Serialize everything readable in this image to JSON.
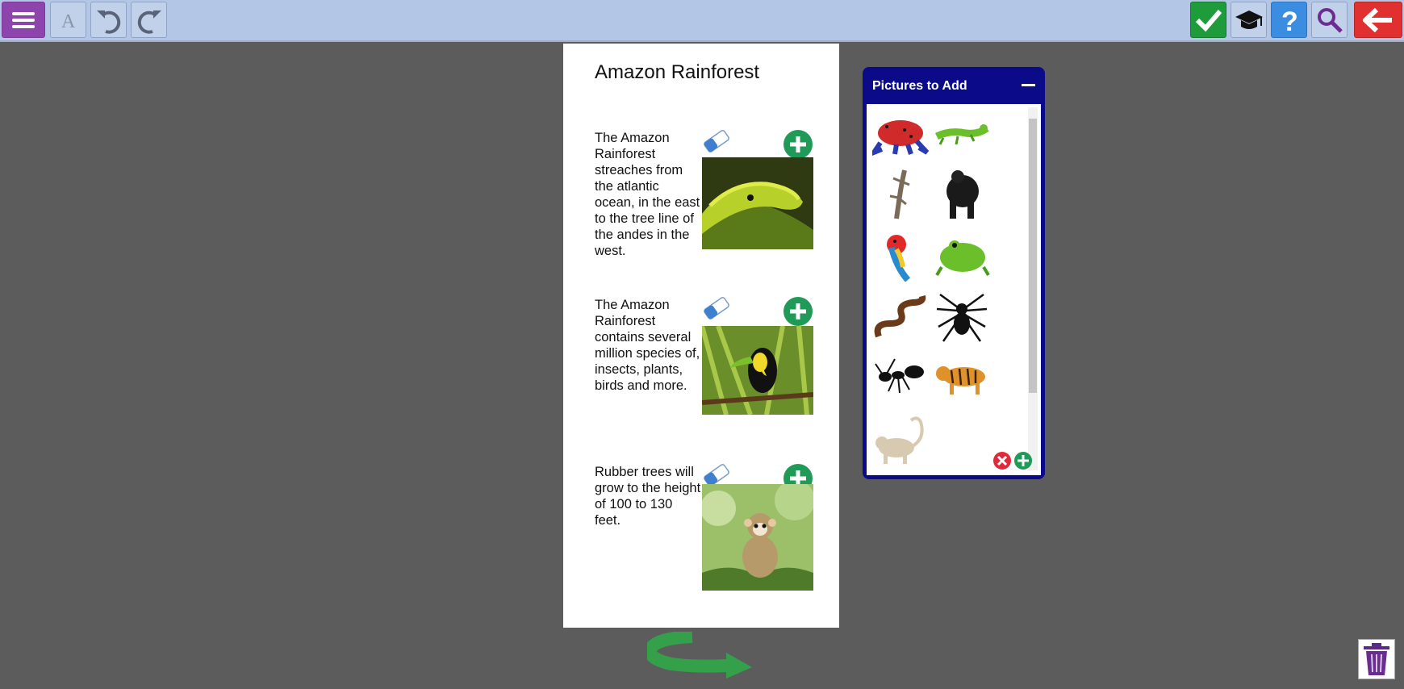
{
  "toolbar": {
    "left_icons": [
      "menu-icon",
      "font-icon",
      "undo-icon",
      "redo-icon"
    ],
    "right_icons": [
      "check-icon",
      "graduation-cap-icon",
      "help-icon",
      "search-icon",
      "back-arrow-icon"
    ],
    "colors": {
      "menu": "#8e44ad",
      "check": "#1e9c3c",
      "help": "#3a8de0",
      "back": "#e03030"
    }
  },
  "page": {
    "title": "Amazon Rainforest",
    "sections": [
      {
        "text": "The Amazon Rainforest streaches from the atlantic ocean, in the east to the tree line of the andes in the west.",
        "image": "snake-photo"
      },
      {
        "text": "The Amazon Rainforest contains several million species of, insects, plants, birds and more.",
        "image": "toucan-photo"
      },
      {
        "text": "Rubber trees will grow to the height of 100 to 130 feet.",
        "image": "monkey-photo"
      }
    ]
  },
  "panel": {
    "title": "Pictures to Add",
    "items": [
      "poison-dart-frog",
      "iguana",
      "lizard",
      "gorilla",
      "macaw-parrot",
      "tree-frog",
      "snake",
      "spider",
      "ant",
      "tiger",
      "monkey"
    ],
    "action_icons": [
      "remove-icon",
      "add-icon"
    ]
  },
  "footer": {
    "icons": [
      "rotate-arrow-icon",
      "trash-icon"
    ]
  }
}
